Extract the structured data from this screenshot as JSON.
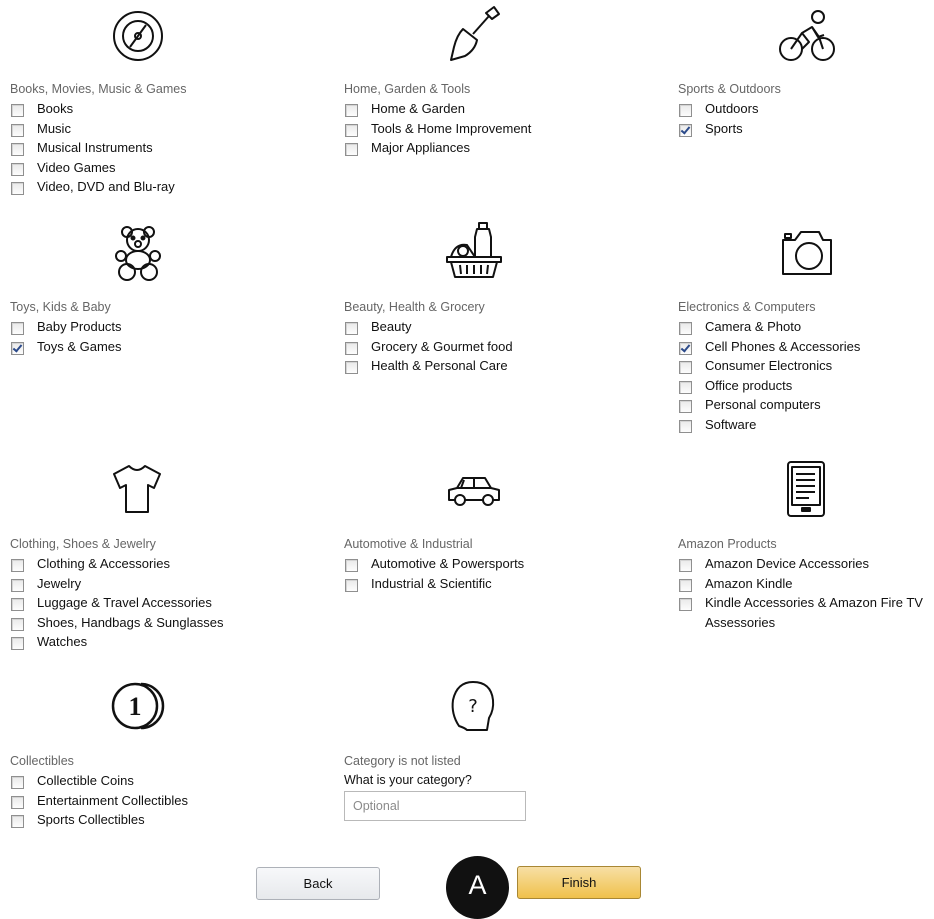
{
  "categories": [
    {
      "title": "Books, Movies, Music & Games",
      "icon": "vinyl-disc-icon",
      "options": [
        {
          "label": "Books",
          "checked": false
        },
        {
          "label": "Music",
          "checked": false
        },
        {
          "label": "Musical Instruments",
          "checked": false
        },
        {
          "label": "Video Games",
          "checked": false
        },
        {
          "label": "Video, DVD and Blu-ray",
          "checked": false
        }
      ]
    },
    {
      "title": "Home, Garden & Tools",
      "icon": "shovel-icon",
      "options": [
        {
          "label": "Home & Garden",
          "checked": false
        },
        {
          "label": "Tools & Home Improvement",
          "checked": false
        },
        {
          "label": "Major Appliances",
          "checked": false
        }
      ]
    },
    {
      "title": "Sports & Outdoors",
      "icon": "cyclist-icon",
      "options": [
        {
          "label": "Outdoors",
          "checked": false
        },
        {
          "label": "Sports",
          "checked": true
        }
      ]
    },
    {
      "title": "Toys, Kids & Baby",
      "icon": "teddy-bear-icon",
      "options": [
        {
          "label": "Baby Products",
          "checked": false
        },
        {
          "label": "Toys & Games",
          "checked": true
        }
      ]
    },
    {
      "title": "Beauty, Health & Grocery",
      "icon": "grocery-basket-icon",
      "options": [
        {
          "label": "Beauty",
          "checked": false
        },
        {
          "label": "Grocery & Gourmet food",
          "checked": false
        },
        {
          "label": "Health & Personal Care",
          "checked": false
        }
      ]
    },
    {
      "title": "Electronics & Computers",
      "icon": "camera-icon",
      "options": [
        {
          "label": "Camera & Photo",
          "checked": false
        },
        {
          "label": "Cell Phones & Accessories",
          "checked": true
        },
        {
          "label": "Consumer Electronics",
          "checked": false
        },
        {
          "label": "Office products",
          "checked": false
        },
        {
          "label": "Personal computers",
          "checked": false
        },
        {
          "label": "Software",
          "checked": false
        }
      ]
    },
    {
      "title": "Clothing, Shoes & Jewelry",
      "icon": "tshirt-icon",
      "options": [
        {
          "label": "Clothing & Accessories",
          "checked": false
        },
        {
          "label": "Jewelry",
          "checked": false
        },
        {
          "label": "Luggage & Travel Accessories",
          "checked": false
        },
        {
          "label": "Shoes, Handbags & Sunglasses",
          "checked": false
        },
        {
          "label": "Watches",
          "checked": false
        }
      ]
    },
    {
      "title": "Automotive & Industrial",
      "icon": "car-icon",
      "options": [
        {
          "label": "Automotive & Powersports",
          "checked": false
        },
        {
          "label": "Industrial & Scientific",
          "checked": false
        }
      ]
    },
    {
      "title": "Amazon Products",
      "icon": "ereader-icon",
      "options": [
        {
          "label": "Amazon Device Accessories",
          "checked": false
        },
        {
          "label": "Amazon Kindle",
          "checked": false
        },
        {
          "label": "Kindle Accessories & Amazon Fire TV Assessories",
          "checked": false
        }
      ]
    },
    {
      "title": "Collectibles",
      "icon": "coins-icon",
      "options": [
        {
          "label": "Collectible Coins",
          "checked": false
        },
        {
          "label": "Entertainment Collectibles",
          "checked": false
        },
        {
          "label": "Sports Collectibles",
          "checked": false
        }
      ]
    }
  ],
  "other": {
    "title": "Category is not listed",
    "icon": "question-head-icon",
    "prompt": "What is your category?",
    "value": "",
    "placeholder": "Optional"
  },
  "buttons": {
    "back": "Back",
    "finish": "Finish"
  },
  "marker": {
    "label": "A"
  }
}
